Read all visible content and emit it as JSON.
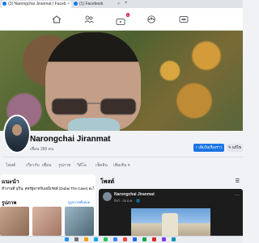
{
  "browser": {
    "tabs": [
      {
        "label": "(3) Narongchai Jiranmat | Faceb"
      },
      {
        "label": "(1) Facebook"
      }
    ],
    "new_tab_symbol": "+",
    "close_symbol": "×"
  },
  "topnav": {
    "icons": [
      "home-icon",
      "friends-icon",
      "watch-icon",
      "groups-icon",
      "gaming-icon"
    ],
    "badge": "1"
  },
  "profile": {
    "name": "Narongchai Jiranmat",
    "friends": "เพื่อน 289 คน",
    "add_story_label": "เพิ่มในเรื่องราว",
    "edit_label": "แก้ไข"
  },
  "tabs": [
    "โพสต์",
    "เกี่ยวกับ",
    "เพื่อน",
    "รูปภาพ",
    "วิดีโอ",
    "เช็คอิน",
    "เพิ่มเติม"
  ],
  "intro": {
    "title": "แนะนำ",
    "line": "ทำงานที่ บุกิน, สหรัฐอาหรับเอมิเรตส์ (Dubai The Cave) อะไร",
    "photos_label": "รูปภาพ",
    "photos_link": "ดูรูปภาพทั้งหมด"
  },
  "posts": {
    "title": "โพสต์",
    "filter_symbol": "☰",
    "post": {
      "author": "Narongchai Jiranmat",
      "meta": "ลิงก์ · 28 ต.ค. · 🌐",
      "more_symbol": "···"
    }
  },
  "colors": {
    "brand_blue": "#1b74e4",
    "badge_red": "#e41e3f"
  }
}
